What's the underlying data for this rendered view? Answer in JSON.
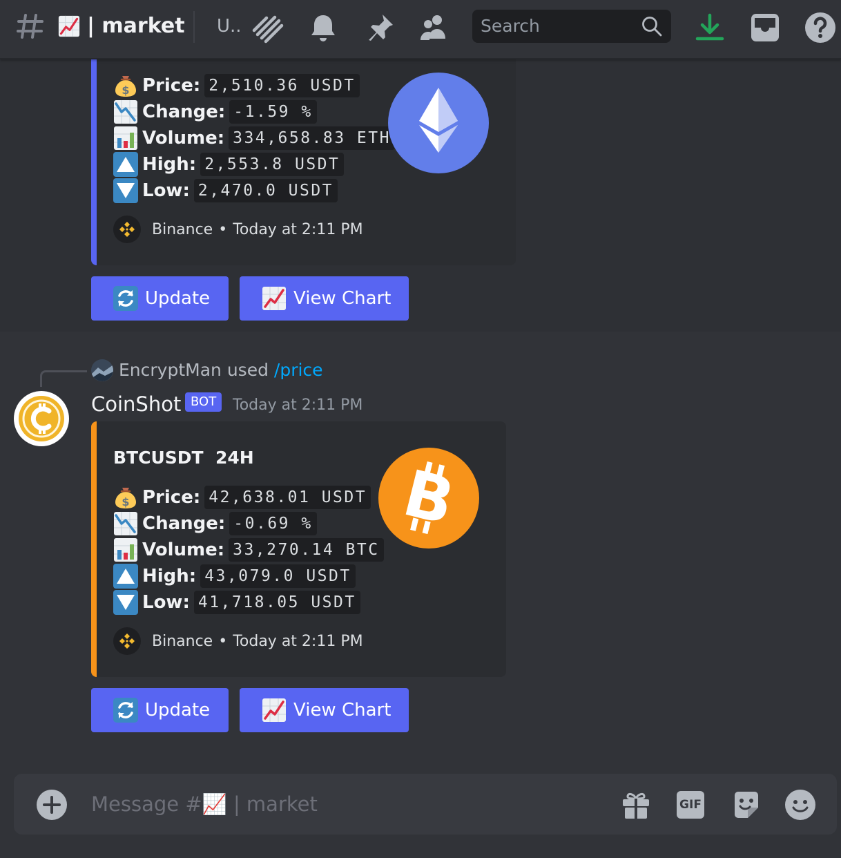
{
  "header": {
    "channel_prefix": "|",
    "channel_name": "market",
    "thread_label": "U..",
    "search_placeholder": "Search"
  },
  "accent_colors": {
    "eth_embed": "#5865f2",
    "btc_embed": "#f7931a",
    "button": "#5865f2",
    "download_icon": "#23a55a"
  },
  "messages": [
    {
      "embed": {
        "fields": [
          {
            "icon": "money-bag-icon",
            "label": "Price:",
            "value": "2,510.36 USDT"
          },
          {
            "icon": "chart-decreasing-icon",
            "label": "Change:",
            "value": "-1.59 %"
          },
          {
            "icon": "bar-chart-icon",
            "label": "Volume:",
            "value": "334,658.83 ETH"
          },
          {
            "icon": "up-arrow-icon",
            "label": "High:",
            "value": "2,553.8 USDT"
          },
          {
            "icon": "down-arrow-icon",
            "label": "Low:",
            "value": "2,470.0 USDT"
          }
        ],
        "footer": {
          "source": "Binance",
          "separator": "•",
          "time": "Today at 2:11 PM"
        },
        "thumbnail": "ethereum-logo"
      },
      "buttons": {
        "update": "Update",
        "view_chart": "View Chart"
      }
    },
    {
      "reply": {
        "user": "EncryptMan",
        "used": "used",
        "command": "/price"
      },
      "author": "CoinShot",
      "badge": "BOT",
      "timestamp": "Today at 2:11 PM",
      "embed": {
        "title": "BTCUSDT  24H",
        "fields": [
          {
            "icon": "money-bag-icon",
            "label": "Price:",
            "value": "42,638.01 USDT"
          },
          {
            "icon": "chart-decreasing-icon",
            "label": "Change:",
            "value": "-0.69 %"
          },
          {
            "icon": "bar-chart-icon",
            "label": "Volume:",
            "value": "33,270.14 BTC"
          },
          {
            "icon": "up-arrow-icon",
            "label": "High:",
            "value": "43,079.0 USDT"
          },
          {
            "icon": "down-arrow-icon",
            "label": "Low:",
            "value": "41,718.05 USDT"
          }
        ],
        "footer": {
          "source": "Binance",
          "separator": "•",
          "time": "Today at 2:11 PM"
        },
        "thumbnail": "bitcoin-logo"
      },
      "buttons": {
        "update": "Update",
        "view_chart": "View Chart"
      }
    }
  ],
  "composer": {
    "placeholder": "Message #📈 | market",
    "gif_label": "GIF"
  }
}
